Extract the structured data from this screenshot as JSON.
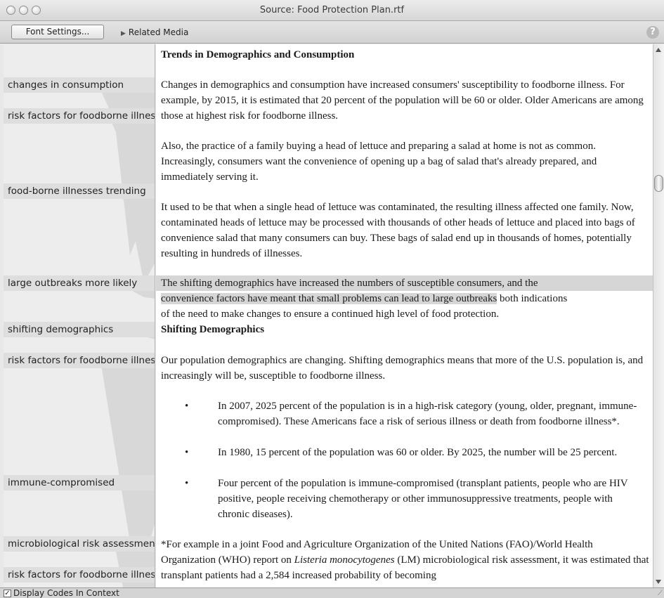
{
  "window": {
    "title": "Source: Food Protection Plan.rtf"
  },
  "toolbar": {
    "font_settings_label": "Font Settings...",
    "related_media_label": "Related Media",
    "help_icon": "question-mark-icon"
  },
  "codes": [
    "changes in consumption",
    "risk factors for foodborne illness",
    "food-borne illnesses trending",
    "large outbreaks more likely",
    "shifting demographics",
    "risk factors for foodborne illness",
    "immune-compromised",
    "microbiological risk assessment",
    "risk factors for foodborne illness"
  ],
  "document": {
    "heading_trends": "Trends in Demographics and Consumption",
    "para1": "Changes in demographics and consumption have increased consumers' susceptibility to foodborne illness. For example, by 2015, it is estimated that 20 percent of the population will be 60 or older. Older Americans are among those at highest risk for foodborne illness.",
    "para2": "Also, the practice of a family buying a head of lettuce and preparing a salad at home is not as common. Increasingly, consumers want the convenience of opening up a bag of salad that's already prepared, and immediately serving it.",
    "para3": "It used to be that when a single head of lettuce was contaminated, the resulting illness affected one family. Now, contaminated heads of lettuce may be processed with thousands of other heads of lettuce and placed into bags of convenience salad that many consumers can buy. These bags of salad end up in thousands of homes, potentially resulting in hundreds of illnesses.",
    "para4_line1": "The shifting demographics have increased the numbers of susceptible consumers, and the",
    "para4_line2_hl": "convenience factors have meant that small problems can lead to large outbreaks",
    "para4_line2_rest": " both indications",
    "para4_line3": "of the need to make changes to ensure a continued high level of food protection.",
    "heading_shifting": "Shifting Demographics",
    "para5": "Our population demographics are changing. Shifting demographics means that more of the U.S. population is, and increasingly will be, susceptible to foodborne illness.",
    "bullet_char": "•",
    "bullets": [
      "In 2007, 2025 percent of the population is in a high-risk category (young, older, pregnant, immune-compromised). These Americans face a risk of serious illness or death from foodborne illness*.",
      "In 1980, 15 percent of the population was 60 or older. By 2025, the number will be 25 percent.",
      "Four percent of the population is immune-compromised (transplant patients, people who are HIV positive, people receiving chemotherapy or other immunosuppressive treatments, people with chronic diseases)."
    ],
    "footnote_part1": "*For example in a joint Food and Agriculture Organization of the United Nations (FAO)/World Health Organization (WHO) report on ",
    "footnote_italic": "Listeria monocytogenes",
    "footnote_part2": " (LM) microbiological risk assessment, it was estimated that transplant patients had a 2,584 increased probability of becoming"
  },
  "bottom": {
    "display_codes_label": "Display Codes In Context",
    "display_codes_checked": true
  }
}
